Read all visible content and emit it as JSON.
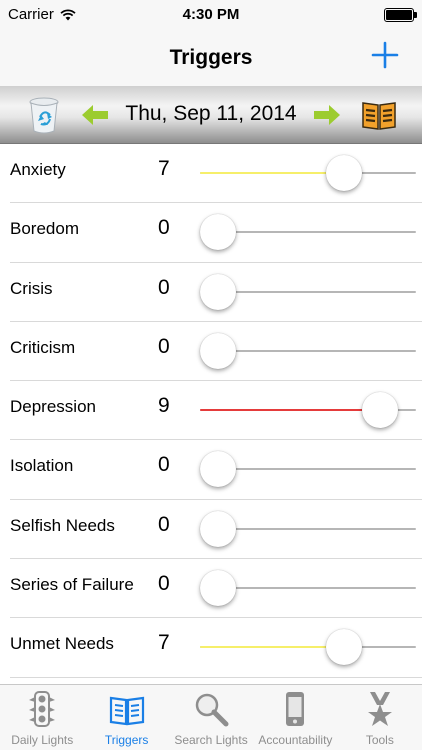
{
  "status_bar": {
    "carrier": "Carrier",
    "time": "4:30 PM"
  },
  "nav": {
    "title": "Triggers"
  },
  "date_bar": {
    "date": "Thu, Sep 11, 2014"
  },
  "colors": {
    "accent": "#1a7fe6",
    "arrow": "#9ccc2f",
    "low_fill": "#f6ef6a",
    "high_fill": "#e53b3b",
    "track": "#b6b6b6"
  },
  "slider_max": 10,
  "triggers": [
    {
      "name": "Anxiety",
      "value": "7",
      "level": 7,
      "fill": "low"
    },
    {
      "name": "Boredom",
      "value": "0",
      "level": 0,
      "fill": "none"
    },
    {
      "name": "Crisis",
      "value": "0",
      "level": 0,
      "fill": "none"
    },
    {
      "name": "Criticism",
      "value": "0",
      "level": 0,
      "fill": "none"
    },
    {
      "name": "Depression",
      "value": "9",
      "level": 9,
      "fill": "high"
    },
    {
      "name": "Isolation",
      "value": "0",
      "level": 0,
      "fill": "none"
    },
    {
      "name": "Selfish Needs",
      "value": "0",
      "level": 0,
      "fill": "none"
    },
    {
      "name": "Series of Failure",
      "value": "0",
      "level": 0,
      "fill": "none"
    },
    {
      "name": "Unmet Needs",
      "value": "7",
      "level": 7,
      "fill": "low"
    }
  ],
  "tabs": [
    {
      "label": "Daily Lights",
      "icon": "traffic-light-icon",
      "active": false
    },
    {
      "label": "Triggers",
      "icon": "book-icon",
      "active": true
    },
    {
      "label": "Search Lights",
      "icon": "magnifier-icon",
      "active": false
    },
    {
      "label": "Accountability",
      "icon": "phone-icon",
      "active": false
    },
    {
      "label": "Tools",
      "icon": "medal-icon",
      "active": false
    }
  ]
}
